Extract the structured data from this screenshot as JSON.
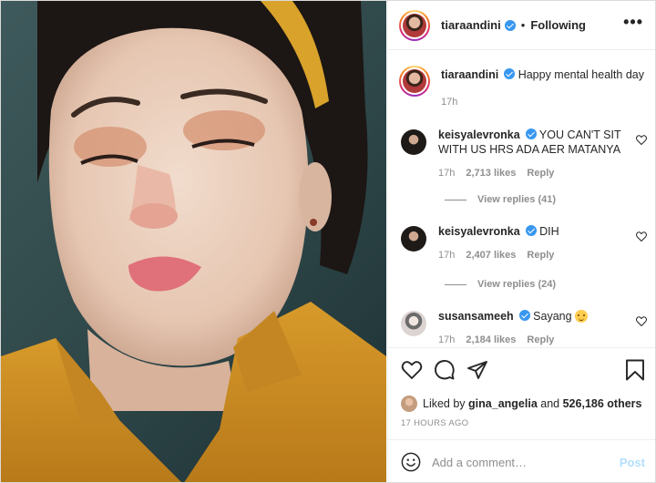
{
  "post": {
    "author": "tiaraandini",
    "follow_status": "Following",
    "separator": "•",
    "more_label": "•••",
    "caption": {
      "username": "tiaraandini",
      "text": "Happy mental health day",
      "time": "17h"
    },
    "comments": [
      {
        "username": "keisyalevronka",
        "text": "YOU CAN'T SIT WITH US HRS ADA AER MATANYA",
        "time": "17h",
        "likes": "2,713 likes",
        "reply_label": "Reply",
        "view_replies": "View replies (41)"
      },
      {
        "username": "keisyalevronka",
        "text": "DIH",
        "time": "17h",
        "likes": "2,407 likes",
        "reply_label": "Reply",
        "view_replies": "View replies (24)"
      },
      {
        "username": "susansameeh",
        "text": "Sayang",
        "emoji": "smiling-face-emoji",
        "time": "17h",
        "likes": "2,184 likes",
        "reply_label": "Reply"
      }
    ],
    "likes": {
      "prefix": "Liked by",
      "user": "gina_angelia",
      "conj": "and",
      "others": "526,186 others"
    },
    "timestamp": "17 HOURS AGO",
    "add_comment": {
      "placeholder": "Add a comment…",
      "post_label": "Post"
    }
  },
  "colors": {
    "verified": "#3897f0",
    "secondary_text": "#8e8e8e",
    "post_button_disabled": "#b2dffc"
  }
}
